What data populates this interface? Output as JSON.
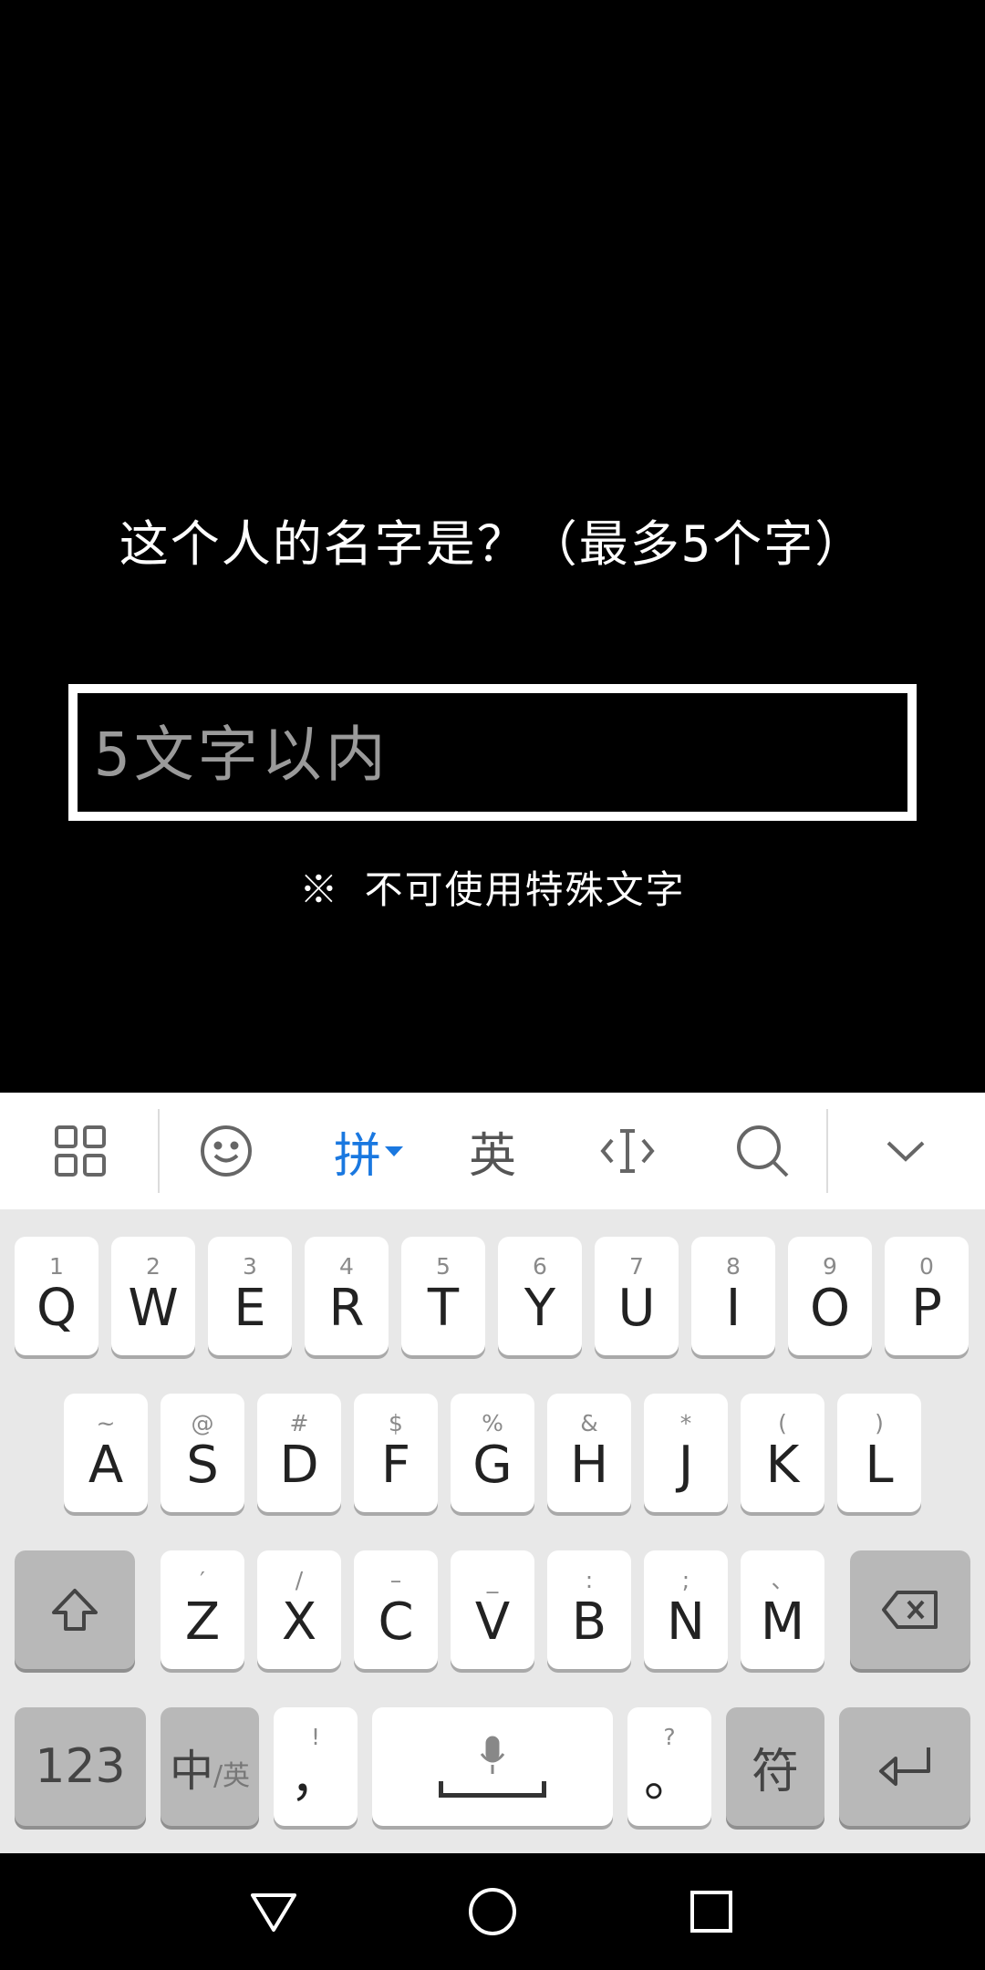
{
  "game": {
    "prompt": "这个人的名字是？（最多5个字）",
    "name_placeholder": "5文字以内",
    "note": "※ 不可使用特殊文字"
  },
  "toolbar": {
    "grid_icon": "grid-icon",
    "emoji_icon": "emoji-icon",
    "pinyin_label": "拼",
    "english_label": "英",
    "cursor_icon": "text-cursor-icon",
    "search_icon": "search-icon",
    "collapse_icon": "chevron-down-icon"
  },
  "keyboard": {
    "row1": [
      {
        "hint": "1",
        "key": "Q"
      },
      {
        "hint": "2",
        "key": "W"
      },
      {
        "hint": "3",
        "key": "E"
      },
      {
        "hint": "4",
        "key": "R"
      },
      {
        "hint": "5",
        "key": "T"
      },
      {
        "hint": "6",
        "key": "Y"
      },
      {
        "hint": "7",
        "key": "U"
      },
      {
        "hint": "8",
        "key": "I"
      },
      {
        "hint": "9",
        "key": "O"
      },
      {
        "hint": "0",
        "key": "P"
      }
    ],
    "row2": [
      {
        "hint": "~",
        "key": "A"
      },
      {
        "hint": "@",
        "key": "S"
      },
      {
        "hint": "#",
        "key": "D"
      },
      {
        "hint": "$",
        "key": "F"
      },
      {
        "hint": "%",
        "key": "G"
      },
      {
        "hint": "&",
        "key": "H"
      },
      {
        "hint": "*",
        "key": "J"
      },
      {
        "hint": "(",
        "key": "K"
      },
      {
        "hint": ")",
        "key": "L"
      }
    ],
    "row3": [
      {
        "hint": "′",
        "key": "Z"
      },
      {
        "hint": "/",
        "key": "X"
      },
      {
        "hint": "–",
        "key": "C"
      },
      {
        "hint": "_",
        "key": "V"
      },
      {
        "hint": ":",
        "key": "B"
      },
      {
        "hint": ";",
        "key": "N"
      },
      {
        "hint": "、",
        "key": "M"
      }
    ],
    "shift_icon": "shift-icon",
    "backspace_icon": "backspace-icon",
    "num_label": "123",
    "lang_main": "中",
    "lang_sub": "/英",
    "comma_hint": "!",
    "comma_key": "，",
    "mic_icon": "microphone-icon",
    "period_hint": "?",
    "period_key": "。",
    "symbol_label": "符",
    "enter_icon": "enter-icon"
  },
  "navbar": {
    "back_icon": "back-triangle-icon",
    "home_icon": "home-circle-icon",
    "recents_icon": "recents-square-icon"
  },
  "colors": {
    "accent": "#1a78e0",
    "keyboard_bg": "#e8e8e8",
    "key_bg": "#ffffff",
    "dark_key_bg": "#b8b8b8"
  }
}
